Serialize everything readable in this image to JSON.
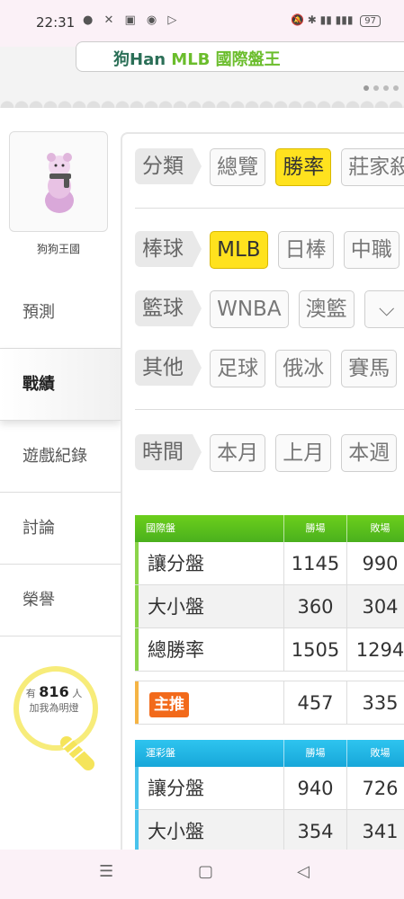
{
  "status": {
    "time": "22:31",
    "battery": "97"
  },
  "banner": {
    "title_prefix": "狗Han ",
    "title_mlb": "MLB",
    "title_suffix": " 國際盤王"
  },
  "sidebar": {
    "user_name": "狗狗王國",
    "items": [
      {
        "label": "預測"
      },
      {
        "label": "戰績"
      },
      {
        "label": "遊戲紀錄"
      },
      {
        "label": "討論"
      },
      {
        "label": "榮譽"
      }
    ],
    "light": {
      "prefix": "有",
      "count": "816",
      "suffix": "人",
      "caption": "加我為明燈"
    }
  },
  "filters": {
    "category": {
      "tag": "分類",
      "chips": [
        "總覽",
        "勝率",
        "莊家殺"
      ]
    },
    "baseball": {
      "tag": "棒球",
      "chips": [
        "MLB",
        "日棒",
        "中職"
      ]
    },
    "basketball": {
      "tag": "籃球",
      "chips": [
        "WNBA",
        "澳籃"
      ]
    },
    "other": {
      "tag": "其他",
      "chips": [
        "足球",
        "俄冰",
        "賽馬"
      ]
    },
    "time": {
      "tag": "時間",
      "chips": [
        "本月",
        "上月",
        "本週"
      ]
    }
  },
  "intl_table": {
    "header": [
      "國際盤",
      "勝場",
      "敗場"
    ],
    "rows": [
      {
        "label": "讓分盤",
        "win": "1145",
        "lose": "990"
      },
      {
        "label": "大小盤",
        "win": "360",
        "lose": "304"
      },
      {
        "label": "總勝率",
        "win": "1505",
        "lose": "1294"
      }
    ]
  },
  "main_pick": {
    "label": "主推",
    "win": "457",
    "lose": "335"
  },
  "lottery_table": {
    "header": [
      "運彩盤",
      "勝場",
      "敗場"
    ],
    "rows": [
      {
        "label": "讓分盤",
        "win": "940",
        "lose": "726"
      },
      {
        "label": "大小盤",
        "win": "354",
        "lose": "341"
      }
    ]
  },
  "bottom_nav": {
    "menu": "☰",
    "home": "▢",
    "back": "◁"
  }
}
